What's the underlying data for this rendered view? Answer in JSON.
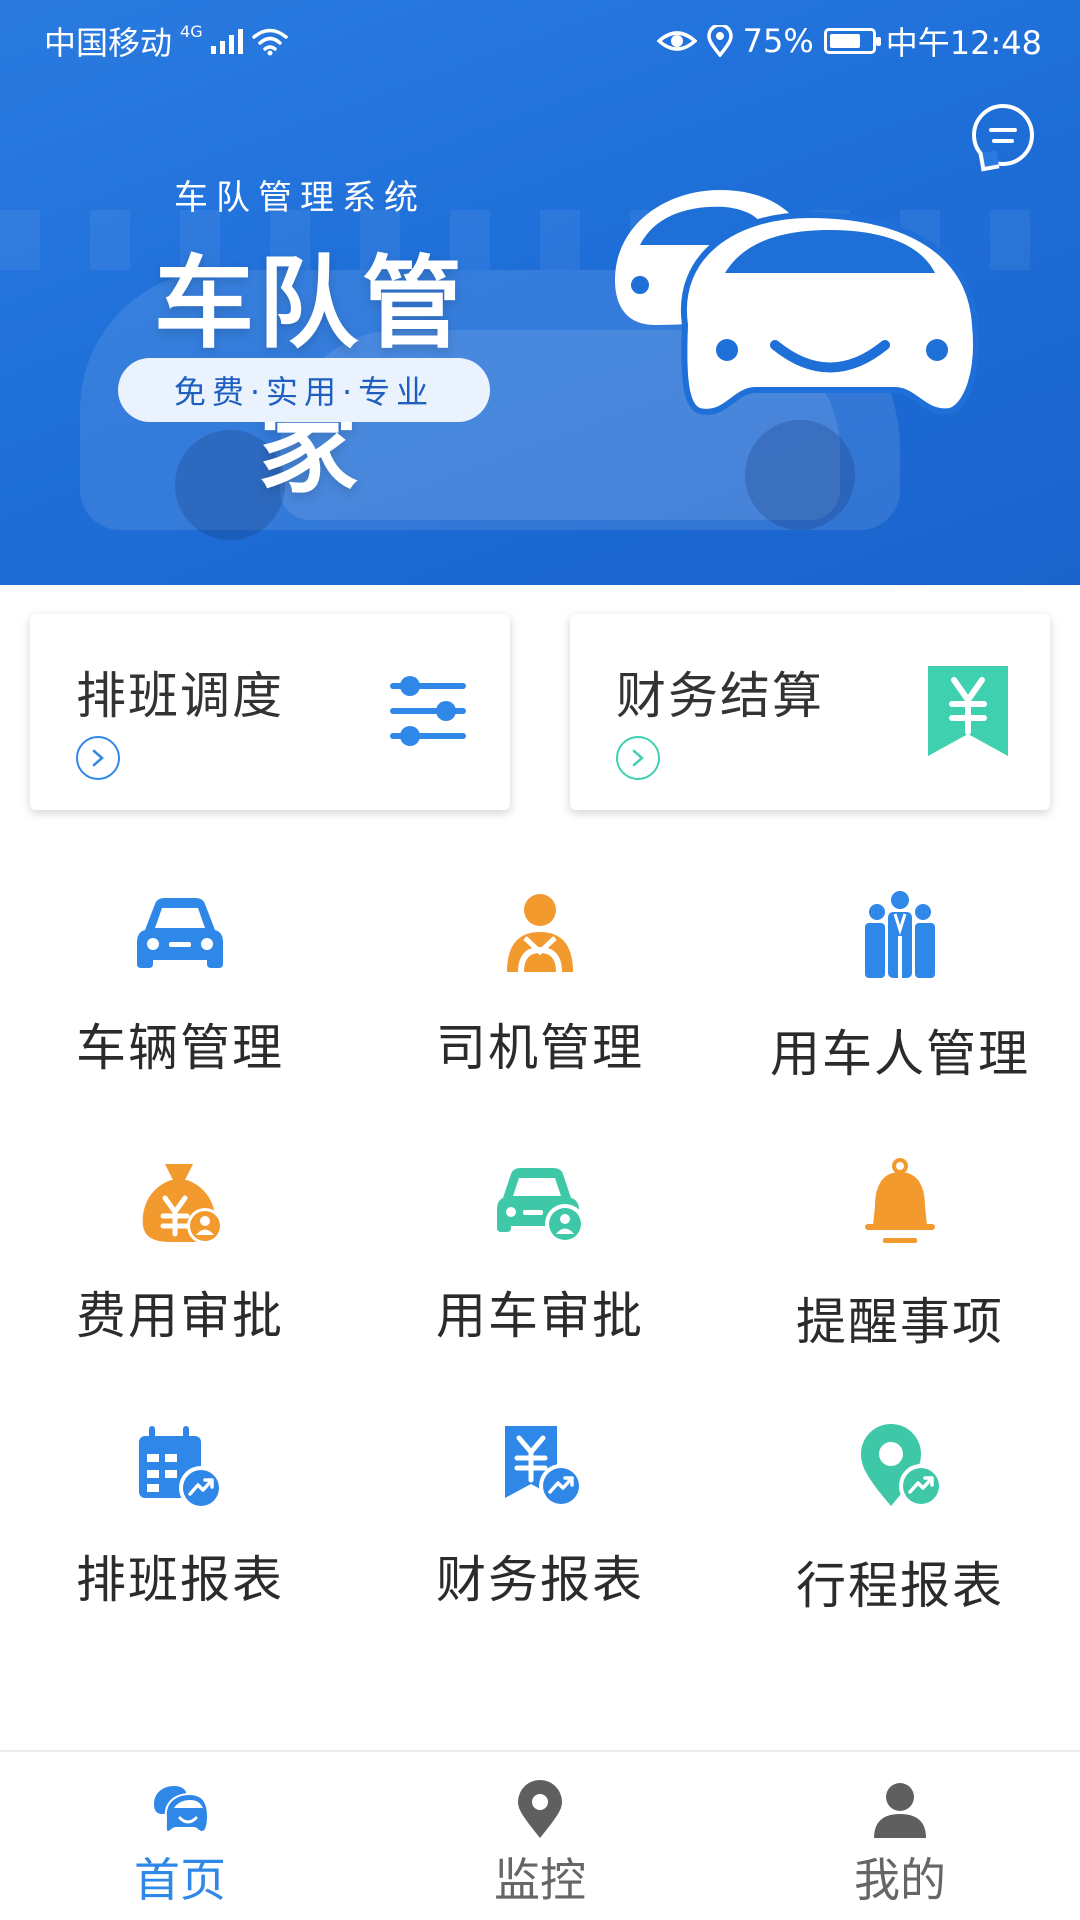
{
  "status_bar": {
    "carrier": "中国移动",
    "network": "4G",
    "battery_percent": "75%",
    "battery_level": 0.75,
    "time": "中午12:48"
  },
  "banner": {
    "subtitle": "车队管理系统",
    "title": "车队管家",
    "tagline": "免费·实用·专业",
    "icons": [
      "message-icon",
      "car-mascot-icon"
    ]
  },
  "feature_cards": [
    {
      "label": "排班调度",
      "icon": "sliders-icon",
      "icon_color": "#2f87e8",
      "arrow_color": "#2f87e8"
    },
    {
      "label": "财务结算",
      "icon": "yuan-bookmark-icon",
      "icon_color": "#3fd0b0",
      "arrow_color": "#3fd0b0"
    }
  ],
  "menu_grid": [
    {
      "label": "车辆管理",
      "icon": "car-icon",
      "color": "#2f87e8"
    },
    {
      "label": "司机管理",
      "icon": "driver-icon",
      "color": "#f29a2e"
    },
    {
      "label": "用车人管理",
      "icon": "people-group-icon",
      "color": "#2f87e8"
    },
    {
      "label": "费用审批",
      "icon": "money-bag-icon",
      "color": "#f29a2e"
    },
    {
      "label": "用车审批",
      "icon": "car-user-icon",
      "color": "#3fc8a8"
    },
    {
      "label": "提醒事项",
      "icon": "bell-icon",
      "color": "#f29a2e"
    },
    {
      "label": "排班报表",
      "icon": "calendar-chart-icon",
      "color": "#2f87e8"
    },
    {
      "label": "财务报表",
      "icon": "yuan-chart-icon",
      "color": "#2f87e8"
    },
    {
      "label": "行程报表",
      "icon": "location-chart-icon",
      "color": "#3fc8a8"
    }
  ],
  "tab_bar": [
    {
      "label": "首页",
      "icon": "home-car-icon",
      "active": true
    },
    {
      "label": "监控",
      "icon": "location-pin-icon",
      "active": false
    },
    {
      "label": "我的",
      "icon": "user-icon",
      "active": false
    }
  ],
  "colors": {
    "primary": "#2f87e8",
    "banner": "#1f6fd9",
    "accent_orange": "#f29a2e",
    "accent_teal": "#3fc8a8",
    "tab_inactive": "#666666"
  }
}
